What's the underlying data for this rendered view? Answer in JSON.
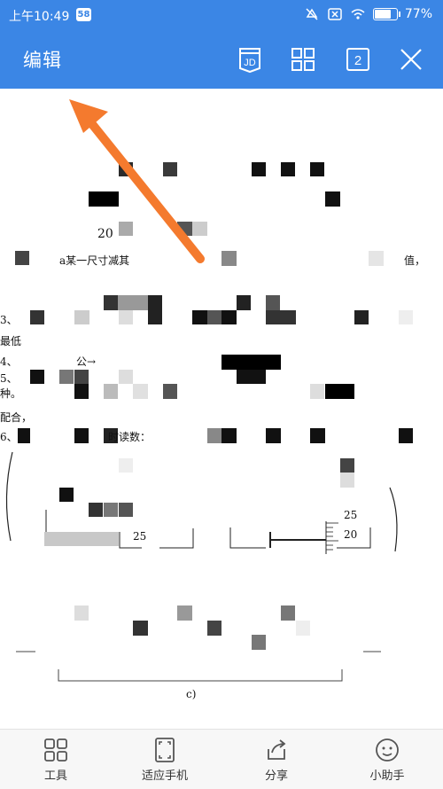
{
  "status_bar": {
    "time": "上午10:49",
    "badge": "58",
    "battery_text": "77%",
    "battery_level": 0.77
  },
  "toolbar": {
    "edit_label": "编辑",
    "jd_label": "JD",
    "page_count": "2"
  },
  "document": {
    "question_number": "20",
    "lines": [
      "a某一尺寸减其",
      "值，",
      "3、",
      "最低",
      "4、",
      "公→",
      "5、",
      "种。",
      "配合，",
      "6、",
      "时读数：",
      "c)"
    ],
    "scale_labels": [
      "25",
      "25",
      "20"
    ]
  },
  "bottom_bar": {
    "items": [
      {
        "label": "工具",
        "icon": "tools-grid-icon"
      },
      {
        "label": "适应手机",
        "icon": "fit-screen-icon"
      },
      {
        "label": "分享",
        "icon": "share-icon"
      },
      {
        "label": "小助手",
        "icon": "assistant-icon"
      }
    ]
  },
  "colors": {
    "primary": "#3b86e5",
    "arrow": "#f47a2e"
  }
}
